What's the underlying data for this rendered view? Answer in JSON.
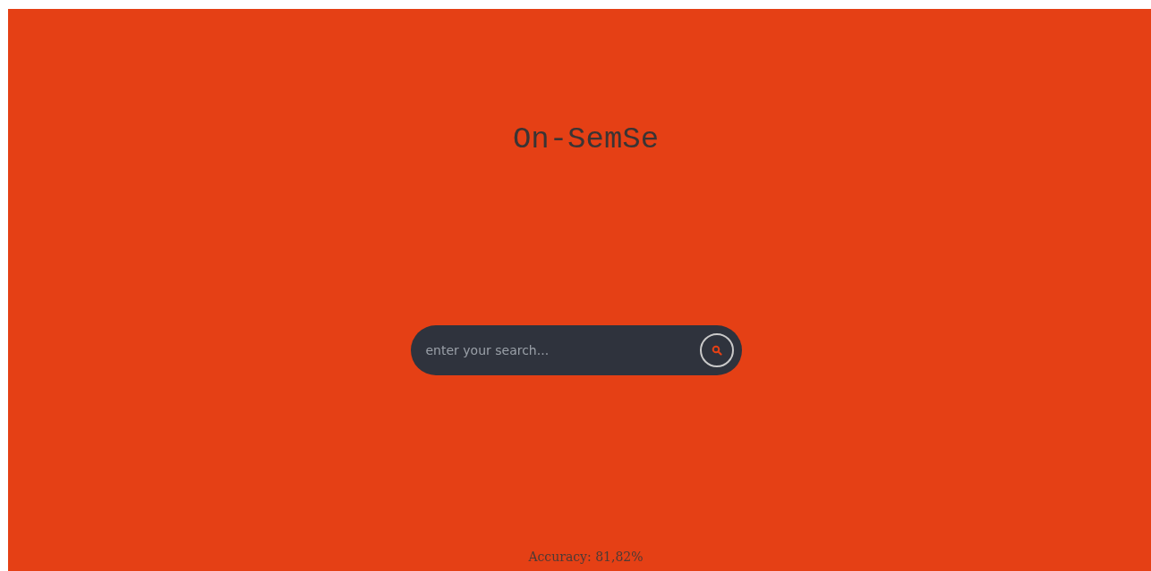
{
  "title": "On-SemSe",
  "search": {
    "placeholder": "enter your search..."
  },
  "accuracy": "Accuracy: 81,82%"
}
